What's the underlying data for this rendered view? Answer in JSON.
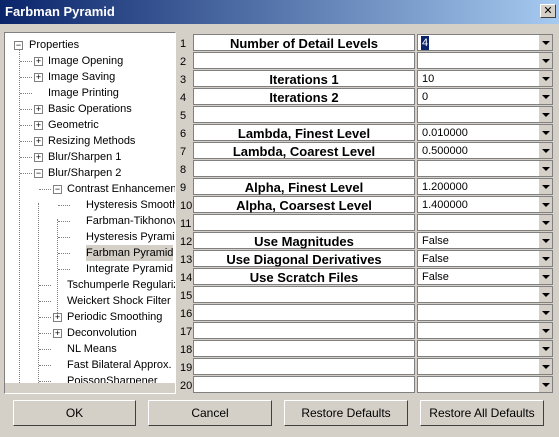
{
  "window": {
    "title": "Farbman Pyramid",
    "close_glyph": "✕"
  },
  "tree": {
    "nodes": [
      {
        "label": "Properties",
        "expander": "−"
      },
      {
        "label": "Image Opening",
        "expander": "+"
      },
      {
        "label": "Image Saving",
        "expander": "+"
      },
      {
        "label": "Image Printing",
        "expander": ""
      },
      {
        "label": "Basic Operations",
        "expander": "+"
      },
      {
        "label": "Geometric",
        "expander": "+"
      },
      {
        "label": "Resizing Methods",
        "expander": "+"
      },
      {
        "label": "Blur/Sharpen 1",
        "expander": "+"
      },
      {
        "label": "Blur/Sharpen 2",
        "expander": "−"
      },
      {
        "label": "Contrast Enhancemen",
        "expander": "−"
      },
      {
        "label": "Hysteresis Smooth",
        "expander": ""
      },
      {
        "label": "Farbman-Tikhonov",
        "expander": ""
      },
      {
        "label": "Hysteresis Pyramid",
        "expander": ""
      },
      {
        "label": "Farbman Pyramid",
        "expander": ""
      },
      {
        "label": "Integrate Pyramid",
        "expander": ""
      },
      {
        "label": "Tschumperle Regulariz",
        "expander": ""
      },
      {
        "label": "Weickert Shock Filter",
        "expander": ""
      },
      {
        "label": "Periodic Smoothing",
        "expander": "+"
      },
      {
        "label": "Deconvolution",
        "expander": "+"
      },
      {
        "label": "NL Means",
        "expander": ""
      },
      {
        "label": "Fast Bilateral Approx.",
        "expander": ""
      },
      {
        "label": "PoissonSharpener",
        "expander": ""
      }
    ]
  },
  "grid": {
    "rows": [
      {
        "num": "1",
        "label": "Number of Detail Levels",
        "value": "4"
      },
      {
        "num": "2",
        "label": "",
        "value": ""
      },
      {
        "num": "3",
        "label": "Iterations 1",
        "value": "10"
      },
      {
        "num": "4",
        "label": "Iterations 2",
        "value": "0"
      },
      {
        "num": "5",
        "label": "",
        "value": ""
      },
      {
        "num": "6",
        "label": "Lambda, Finest Level",
        "value": "0.010000"
      },
      {
        "num": "7",
        "label": "Lambda, Coarest Level",
        "value": "0.500000"
      },
      {
        "num": "8",
        "label": "",
        "value": ""
      },
      {
        "num": "9",
        "label": "Alpha, Finest Level",
        "value": "1.200000"
      },
      {
        "num": "10",
        "label": "Alpha, Coarsest Level",
        "value": "1.400000"
      },
      {
        "num": "11",
        "label": "",
        "value": ""
      },
      {
        "num": "12",
        "label": "Use Magnitudes",
        "value": "False"
      },
      {
        "num": "13",
        "label": "Use Diagonal Derivatives",
        "value": "False"
      },
      {
        "num": "14",
        "label": "Use Scratch Files",
        "value": "False"
      },
      {
        "num": "15",
        "label": "",
        "value": ""
      },
      {
        "num": "16",
        "label": "",
        "value": ""
      },
      {
        "num": "17",
        "label": "",
        "value": ""
      },
      {
        "num": "18",
        "label": "",
        "value": ""
      },
      {
        "num": "19",
        "label": "",
        "value": ""
      },
      {
        "num": "20",
        "label": "",
        "value": ""
      }
    ]
  },
  "buttons": {
    "ok": "OK",
    "cancel": "Cancel",
    "restore_defaults": "Restore Defaults",
    "restore_all_defaults": "Restore All Defaults"
  },
  "colors": {
    "title_start": "#0a246a",
    "title_end": "#a6caf0",
    "face": "#d4d0c8"
  }
}
